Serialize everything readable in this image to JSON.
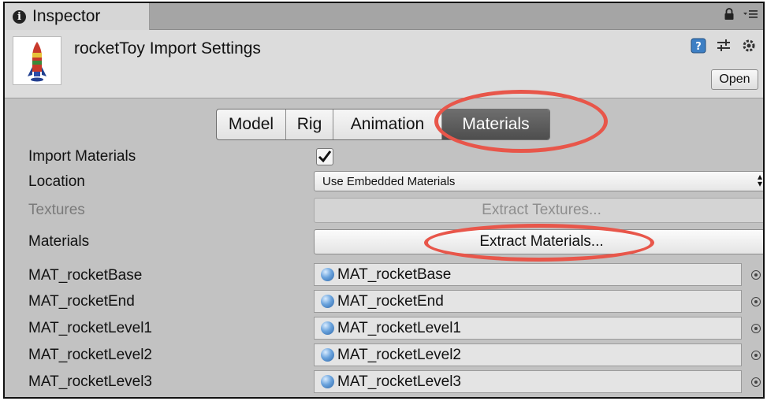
{
  "inspector_tab": {
    "label": "Inspector",
    "icon": "info-icon"
  },
  "header": {
    "title": "rocketToy Import Settings",
    "open_label": "Open",
    "icons": [
      "help-book-icon",
      "preset-sliders-icon",
      "gear-icon"
    ]
  },
  "tabs": [
    {
      "label": "Model",
      "active": false
    },
    {
      "label": "Rig",
      "active": false
    },
    {
      "label": "Animation",
      "active": false
    },
    {
      "label": "Materials",
      "active": true
    }
  ],
  "form": {
    "import_materials": {
      "label": "Import Materials",
      "checked": true
    },
    "location": {
      "label": "Location",
      "value": "Use Embedded Materials"
    },
    "textures": {
      "label": "Textures",
      "button": "Extract Textures...",
      "disabled": true
    },
    "materials": {
      "label": "Materials",
      "button": "Extract Materials..."
    }
  },
  "material_slots": [
    {
      "label": "MAT_rocketBase",
      "value": "MAT_rocketBase"
    },
    {
      "label": "MAT_rocketEnd",
      "value": "MAT_rocketEnd"
    },
    {
      "label": "MAT_rocketLevel1",
      "value": "MAT_rocketLevel1"
    },
    {
      "label": "MAT_rocketLevel2",
      "value": "MAT_rocketLevel2"
    },
    {
      "label": "MAT_rocketLevel3",
      "value": "MAT_rocketLevel3"
    }
  ],
  "annotation_color": "#e8564a"
}
